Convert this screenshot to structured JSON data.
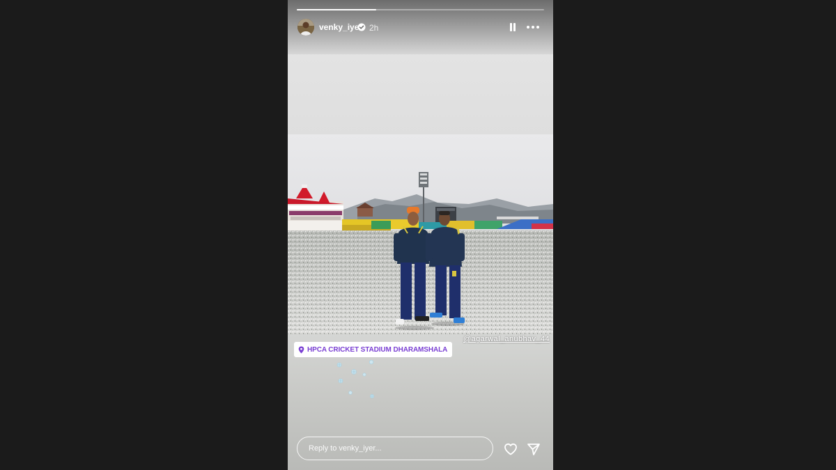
{
  "story": {
    "username": "venky_iyer",
    "timestamp": "2h",
    "progress": 0.32,
    "verified": true,
    "mention": "@agarwal_anubhav_44",
    "location": "HPCA CRICKET STADIUM DHARAMSHALA",
    "reply_placeholder": "Reply to venky_iyer..."
  },
  "icons": {
    "verified": "verified-badge-icon",
    "pause": "pause-icon",
    "more": "more-options-icon",
    "location": "location-pin-icon",
    "like": "heart-icon",
    "share": "send-icon"
  },
  "colors": {
    "background": "#1b1b1b",
    "location_text": "#7a3fd3",
    "verified_badge": "#3797f0"
  }
}
